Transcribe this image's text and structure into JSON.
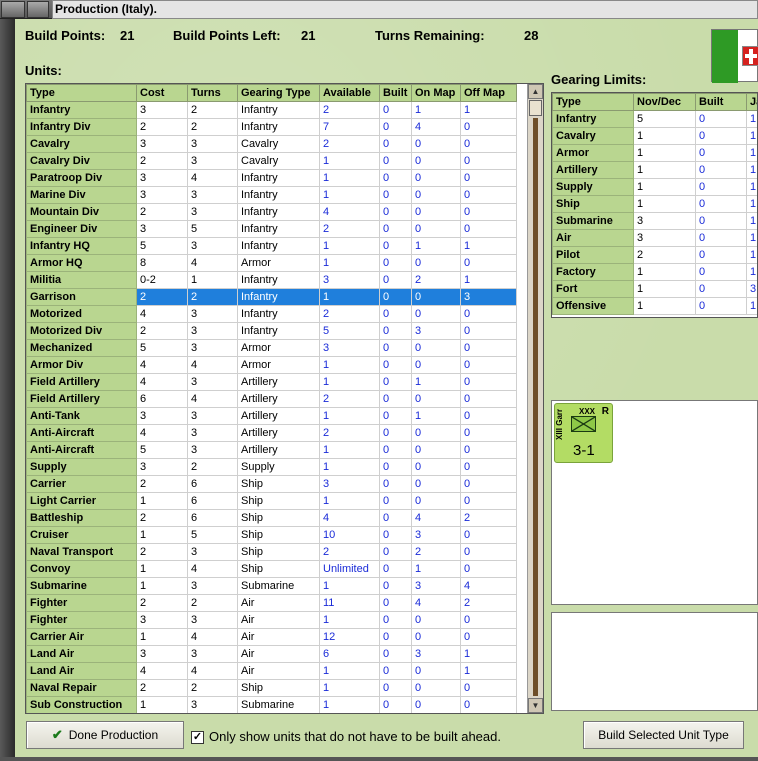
{
  "window": {
    "title": "Production (Italy)."
  },
  "header": {
    "build_points_label": "Build Points:",
    "build_points": "21",
    "build_points_left_label": "Build Points Left:",
    "build_points_left": "21",
    "turns_remaining_label": "Turns Remaining:",
    "turns_remaining": "28"
  },
  "units": {
    "label": "Units:",
    "columns": [
      "Type",
      "Cost",
      "Turns",
      "Gearing Type",
      "Available",
      "Built",
      "On Map",
      "Off Map"
    ],
    "selected_row": 11,
    "rows": [
      [
        "Infantry",
        "3",
        "2",
        "Infantry",
        "2",
        "0",
        "1",
        "1"
      ],
      [
        "Infantry Div",
        "2",
        "2",
        "Infantry",
        "7",
        "0",
        "4",
        "0"
      ],
      [
        "Cavalry",
        "3",
        "3",
        "Cavalry",
        "2",
        "0",
        "0",
        "0"
      ],
      [
        "Cavalry Div",
        "2",
        "3",
        "Cavalry",
        "1",
        "0",
        "0",
        "0"
      ],
      [
        "Paratroop Div",
        "3",
        "4",
        "Infantry",
        "1",
        "0",
        "0",
        "0"
      ],
      [
        "Marine Div",
        "3",
        "3",
        "Infantry",
        "1",
        "0",
        "0",
        "0"
      ],
      [
        "Mountain Div",
        "2",
        "3",
        "Infantry",
        "4",
        "0",
        "0",
        "0"
      ],
      [
        "Engineer Div",
        "3",
        "5",
        "Infantry",
        "2",
        "0",
        "0",
        "0"
      ],
      [
        "Infantry HQ",
        "5",
        "3",
        "Infantry",
        "1",
        "0",
        "1",
        "1"
      ],
      [
        "Armor HQ",
        "8",
        "4",
        "Armor",
        "1",
        "0",
        "0",
        "0"
      ],
      [
        "Militia",
        "0-2",
        "1",
        "Infantry",
        "3",
        "0",
        "2",
        "1"
      ],
      [
        "Garrison",
        "2",
        "2",
        "Infantry",
        "1",
        "0",
        "0",
        "3"
      ],
      [
        "Motorized",
        "4",
        "3",
        "Infantry",
        "2",
        "0",
        "0",
        "0"
      ],
      [
        "Motorized Div",
        "2",
        "3",
        "Infantry",
        "5",
        "0",
        "3",
        "0"
      ],
      [
        "Mechanized",
        "5",
        "3",
        "Armor",
        "3",
        "0",
        "0",
        "0"
      ],
      [
        "Armor Div",
        "4",
        "4",
        "Armor",
        "1",
        "0",
        "0",
        "0"
      ],
      [
        "Field Artillery",
        "4",
        "3",
        "Artillery",
        "1",
        "0",
        "1",
        "0"
      ],
      [
        "Field Artillery",
        "6",
        "4",
        "Artillery",
        "2",
        "0",
        "0",
        "0"
      ],
      [
        "Anti-Tank",
        "3",
        "3",
        "Artillery",
        "1",
        "0",
        "1",
        "0"
      ],
      [
        "Anti-Aircraft",
        "4",
        "3",
        "Artillery",
        "2",
        "0",
        "0",
        "0"
      ],
      [
        "Anti-Aircraft",
        "5",
        "3",
        "Artillery",
        "1",
        "0",
        "0",
        "0"
      ],
      [
        "Supply",
        "3",
        "2",
        "Supply",
        "1",
        "0",
        "0",
        "0"
      ],
      [
        "Carrier",
        "2",
        "6",
        "Ship",
        "3",
        "0",
        "0",
        "0"
      ],
      [
        "Light Carrier",
        "1",
        "6",
        "Ship",
        "1",
        "0",
        "0",
        "0"
      ],
      [
        "Battleship",
        "2",
        "6",
        "Ship",
        "4",
        "0",
        "4",
        "2"
      ],
      [
        "Cruiser",
        "1",
        "5",
        "Ship",
        "10",
        "0",
        "3",
        "0"
      ],
      [
        "Naval Transport",
        "2",
        "3",
        "Ship",
        "2",
        "0",
        "2",
        "0"
      ],
      [
        "Convoy",
        "1",
        "4",
        "Ship",
        "Unlimited",
        "0",
        "1",
        "0"
      ],
      [
        "Submarine",
        "1",
        "3",
        "Submarine",
        "1",
        "0",
        "3",
        "4"
      ],
      [
        "Fighter",
        "2",
        "2",
        "Air",
        "11",
        "0",
        "4",
        "2"
      ],
      [
        "Fighter",
        "3",
        "3",
        "Air",
        "1",
        "0",
        "0",
        "0"
      ],
      [
        "Carrier Air",
        "1",
        "4",
        "Air",
        "12",
        "0",
        "0",
        "0"
      ],
      [
        "Land Air",
        "3",
        "3",
        "Air",
        "6",
        "0",
        "3",
        "1"
      ],
      [
        "Land Air",
        "4",
        "4",
        "Air",
        "1",
        "0",
        "0",
        "1"
      ],
      [
        "Naval Repair",
        "2",
        "2",
        "Ship",
        "1",
        "0",
        "0",
        "0"
      ],
      [
        "Sub Construction",
        "1",
        "3",
        "Submarine",
        "1",
        "0",
        "0",
        "0"
      ]
    ]
  },
  "gearing": {
    "label": "Gearing Limits:",
    "columns": [
      "Type",
      "Nov/Dec",
      "Built",
      "Ja"
    ],
    "rows": [
      [
        "Infantry",
        "5",
        "0",
        "1"
      ],
      [
        "Cavalry",
        "1",
        "0",
        "1"
      ],
      [
        "Armor",
        "1",
        "0",
        "1"
      ],
      [
        "Artillery",
        "1",
        "0",
        "1"
      ],
      [
        "Supply",
        "1",
        "0",
        "1"
      ],
      [
        "Ship",
        "1",
        "0",
        "1"
      ],
      [
        "Submarine",
        "3",
        "0",
        "1"
      ],
      [
        "Air",
        "3",
        "0",
        "1"
      ],
      [
        "Pilot",
        "2",
        "0",
        "1"
      ],
      [
        "Factory",
        "1",
        "0",
        "1"
      ],
      [
        "Fort",
        "1",
        "0",
        "3"
      ],
      [
        "Offensive",
        "1",
        "0",
        "1"
      ]
    ]
  },
  "counter": {
    "size": "XXX",
    "side_text": "XIII Garr",
    "mark": "R",
    "strength": "3-1"
  },
  "footer": {
    "done_label": "Done Production",
    "checkbox_label": "Only show units that do not have to be built ahead.",
    "checkbox_checked": true,
    "build_label": "Build Selected Unit Type"
  },
  "colors": {
    "header_green": "#b9d690",
    "selection_blue": "#1f7fdc",
    "value_blue": "#1a2bd8",
    "flag_green": "#2e9a25",
    "flag_red": "#d5211f"
  },
  "icons": {
    "done": "checkmark-icon",
    "flag": "italy-flag-icon"
  }
}
